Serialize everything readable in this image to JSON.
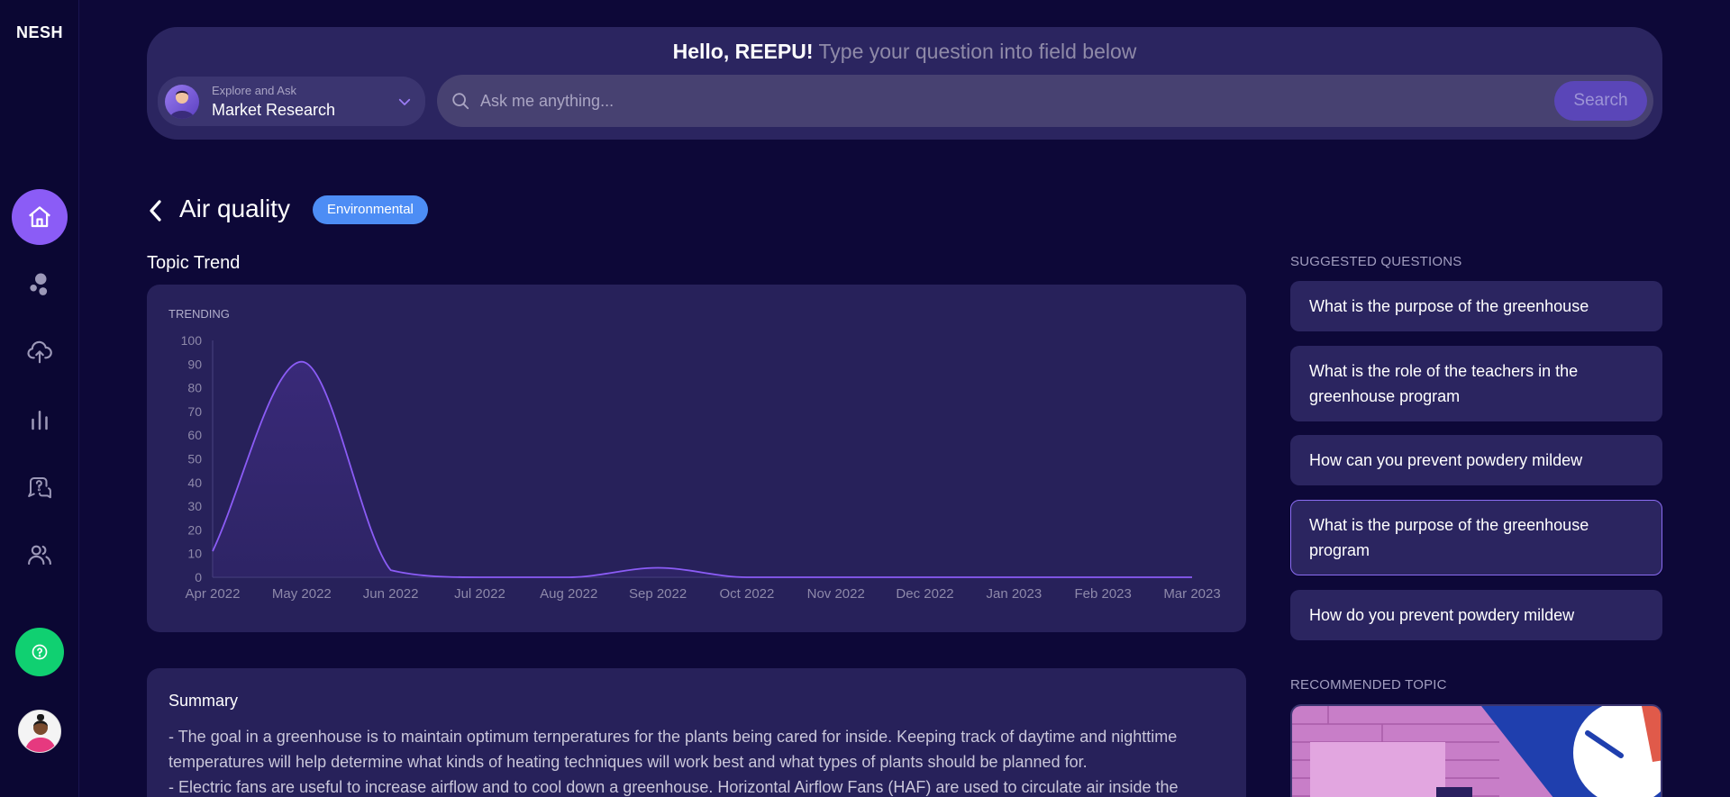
{
  "app": {
    "logo": "NESH"
  },
  "header": {
    "hello": "Hello, REEPU!",
    "subtitle": "Type your question into field below",
    "mode_small": "Explore and Ask",
    "mode_main": "Market Research",
    "search_placeholder": "Ask me anything...",
    "search_button": "Search"
  },
  "page": {
    "title": "Air quality",
    "badge": "Environmental",
    "section_title": "Topic Trend"
  },
  "chart_data": {
    "type": "area",
    "label": "TRENDING",
    "x": [
      "Apr 2022",
      "May 2022",
      "Jun 2022",
      "Jul 2022",
      "Aug 2022",
      "Sep 2022",
      "Oct 2022",
      "Nov 2022",
      "Dec 2022",
      "Jan 2023",
      "Feb 2023",
      "Mar 2023"
    ],
    "values": [
      11,
      91,
      3,
      0,
      0,
      4,
      0,
      0,
      0,
      0,
      0,
      0
    ],
    "ylim": [
      0,
      100
    ],
    "yticks": [
      0,
      10,
      20,
      30,
      40,
      50,
      60,
      70,
      80,
      90,
      100
    ],
    "colors": {
      "line": "#8b5cf6",
      "fill": "#3a2a7a"
    }
  },
  "summary": {
    "title": "Summary",
    "line1": "- The goal in a greenhouse is to maintain optimum ternperatures for the plants being cared for inside. Keeping track of daytime and nighttime temperatures will help determine what kinds of heating techniques will work best and what types of plants should be planned for.",
    "line2": "- Electric fans are useful to increase airflow and to cool down a greenhouse. Horizontal Airflow Fans (HAF) are used to circulate air inside the"
  },
  "suggested": {
    "heading": "SUGGESTED QUESTIONS",
    "items": [
      "What is the purpose of the greenhouse",
      "What is the role of the teachers in the greenhouse program",
      "How can you prevent powdery mildew",
      "What is the purpose of the greenhouse program",
      "How do you prevent powdery mildew"
    ]
  },
  "recommended": {
    "heading": "RECOMMENDED TOPIC"
  }
}
